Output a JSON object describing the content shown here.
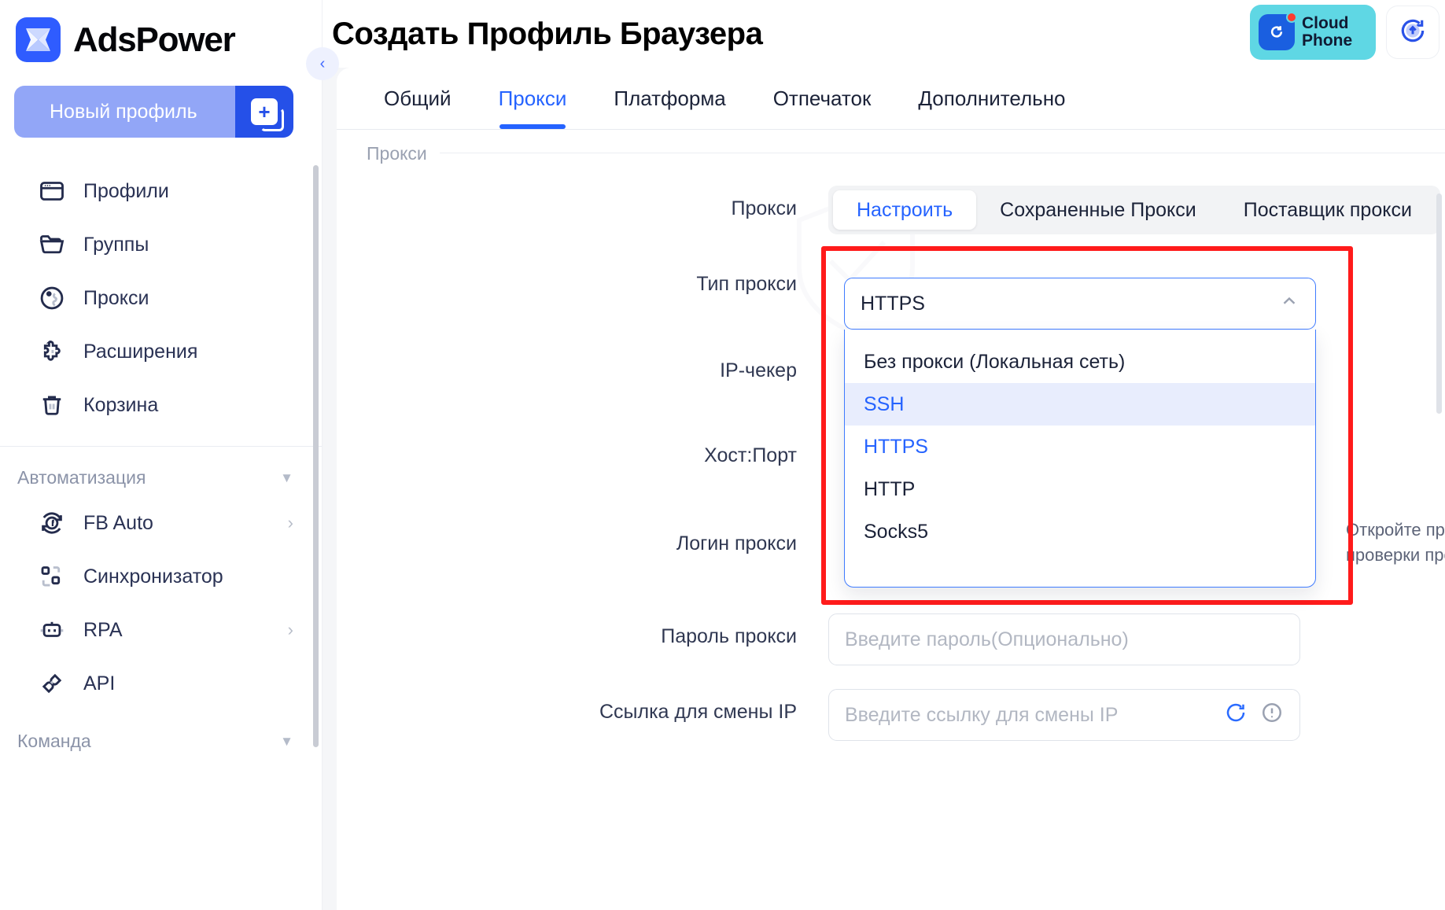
{
  "app": {
    "brand_name": "AdsPower",
    "new_profile_label": "Новый профиль",
    "accent_blue": "#2563ff",
    "brand_blue": "#2f5cff",
    "annotation_red": "#ff1b1b"
  },
  "sidebar": {
    "items": [
      {
        "label": "Профили",
        "icon": "browser-window-icon"
      },
      {
        "label": "Группы",
        "icon": "folder-icon"
      },
      {
        "label": "Прокси",
        "icon": "globe-pin-icon"
      },
      {
        "label": "Расширения",
        "icon": "puzzle-icon"
      },
      {
        "label": "Корзина",
        "icon": "trash-icon"
      }
    ],
    "groups": [
      {
        "label": "Автоматизация",
        "items": [
          {
            "label": "FB Auto",
            "icon": "facebook-refresh-icon",
            "has_chevron": true
          },
          {
            "label": "Синхронизатор",
            "icon": "sync-nodes-icon",
            "has_chevron": false
          },
          {
            "label": "RPA",
            "icon": "robot-icon",
            "has_chevron": true
          },
          {
            "label": "API",
            "icon": "plug-icon",
            "has_chevron": false
          }
        ]
      },
      {
        "label": "Команда",
        "items": []
      }
    ]
  },
  "header": {
    "title": "Создать Профиль Браузера",
    "cloud_phone": {
      "line1": "Cloud",
      "line2": "Phone",
      "icon": "cloud-phone-icon",
      "badge": "notification-dot"
    },
    "upload_icon": "upload-sync-icon"
  },
  "tabs": [
    {
      "label": "Общий",
      "active": false
    },
    {
      "label": "Прокси",
      "active": true
    },
    {
      "label": "Платформа",
      "active": false
    },
    {
      "label": "Отпечаток",
      "active": false
    },
    {
      "label": "Дополнительно",
      "active": false
    }
  ],
  "section": {
    "legend": "Прокси"
  },
  "form": {
    "proxy_mode": {
      "label": "Прокси",
      "options": [
        {
          "label": "Настроить",
          "active": true
        },
        {
          "label": "Сохраненные Прокси",
          "active": false
        },
        {
          "label": "Поставщик прокси",
          "active": false
        }
      ]
    },
    "proxy_type": {
      "label": "Тип прокси",
      "value": "HTTPS",
      "expanded": true,
      "caret_icon": "chevron-up-icon",
      "options": [
        {
          "label": "Без прокси (Локальная сеть)",
          "state": "normal"
        },
        {
          "label": "SSH",
          "state": "hover"
        },
        {
          "label": "HTTPS",
          "state": "selected"
        },
        {
          "label": "HTTP",
          "state": "normal"
        },
        {
          "label": "Socks5",
          "state": "normal"
        }
      ]
    },
    "ip_checker": {
      "label": "IP-чекер"
    },
    "host_port": {
      "label": "Хост:Порт"
    },
    "proxy_login": {
      "label": "Логин прокси"
    },
    "proxy_password": {
      "label": "Пароль прокси",
      "placeholder": "Введите пароль(Опционально)"
    },
    "ip_change_link": {
      "label": "Ссылка для смены IP",
      "placeholder": "Введите ссылку для смены IP",
      "refresh_icon": "refresh-icon",
      "info_icon": "info-circle-icon"
    },
    "hint": "Откройте профиль для проверки прокси"
  }
}
